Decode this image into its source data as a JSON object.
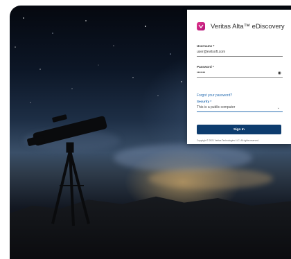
{
  "brand": {
    "title": "Veritas Alta™ eDiscovery",
    "logo_color": "#d12a85"
  },
  "form": {
    "username": {
      "label": "Username *",
      "value": "user@evilsoft.com"
    },
    "password": {
      "label": "Password *",
      "value": "•••••••"
    },
    "forgot_link": "Forgot your password?",
    "security": {
      "label": "Security *",
      "value": "This is a public computer"
    },
    "signin_label": "Sign In",
    "copyright": "Copyright © 2021 Veritas Technologies LLC. All rights reserved."
  },
  "colors": {
    "accent": "#2a6fb3",
    "button": "#0d3c6e"
  },
  "icons": {
    "show_password": "eye-icon",
    "dropdown": "chevron-down-icon",
    "brand": "veritas-logo-icon"
  }
}
